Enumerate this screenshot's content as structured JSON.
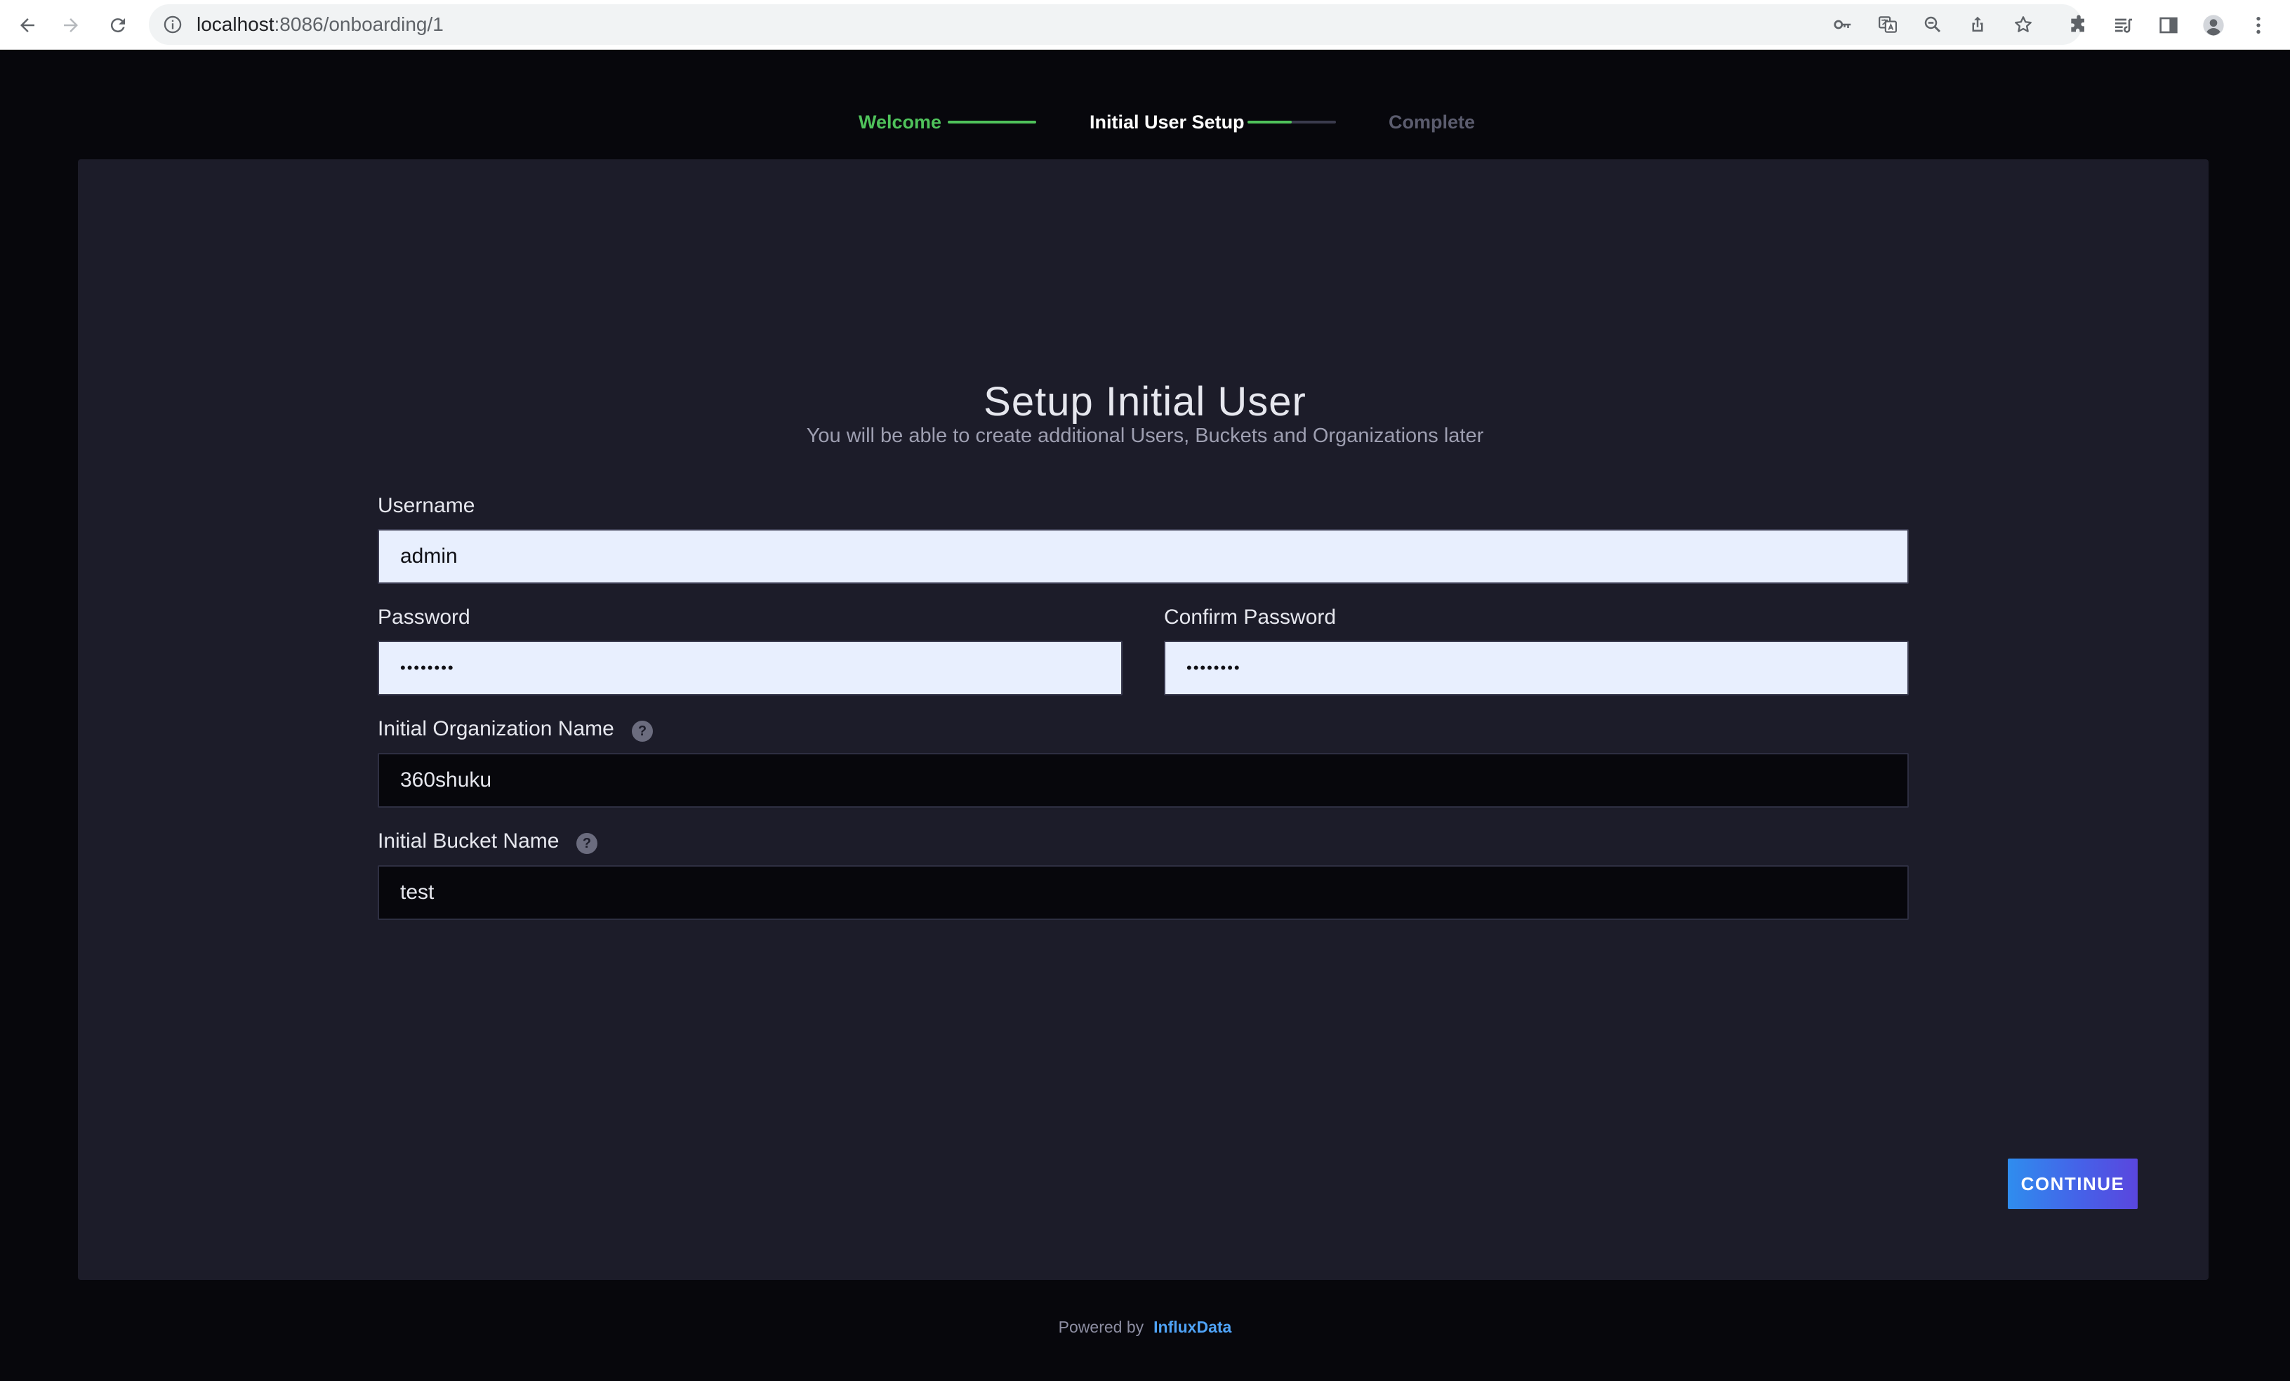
{
  "browser": {
    "url_host": "localhost",
    "url_path": ":8086/onboarding/1",
    "icons": {
      "back": "back-arrow-icon",
      "forward": "forward-arrow-icon",
      "reload": "reload-icon",
      "site_info": "info-icon",
      "passwords": "key-icon",
      "translate": "translate-icon",
      "zoom": "zoom-icon",
      "share": "share-icon",
      "bookmark": "star-icon",
      "extensions": "puzzle-icon",
      "reading_list": "reading-list-icon",
      "side_panel": "side-panel-icon",
      "profile": "avatar-icon",
      "menu": "kebab-menu-icon"
    }
  },
  "stepper": {
    "steps": [
      {
        "label": "Welcome",
        "state": "done",
        "color": "#4fc25b"
      },
      {
        "label": "Initial User Setup",
        "state": "current",
        "color": "#ffffff"
      },
      {
        "label": "Complete",
        "state": "pending",
        "color": "#5b5c6e"
      }
    ],
    "connector_color": "#4fc25b",
    "track_color": "#3a3b4d"
  },
  "form": {
    "title": "Setup Initial User",
    "subtitle": "You will be able to create additional Users, Buckets and Organizations later",
    "username": {
      "label": "Username",
      "value": "admin"
    },
    "password": {
      "label": "Password",
      "value": "••••••••"
    },
    "confirm_password": {
      "label": "Confirm Password",
      "value": "••••••••"
    },
    "organization": {
      "label": "Initial Organization Name",
      "value": "360shuku",
      "help_icon": "help-icon",
      "help_glyph": "?"
    },
    "bucket": {
      "label": "Initial Bucket Name",
      "value": "test",
      "help_icon": "help-icon",
      "help_glyph": "?"
    },
    "continue_label": "CONTINUE"
  },
  "footer": {
    "powered_by": "Powered by",
    "brand": "InfluxData"
  },
  "colors": {
    "page_bg": "#07070c",
    "card_bg": "#1c1c29",
    "accent_blue": "#4fa3f7",
    "success_green": "#4fc25b"
  }
}
